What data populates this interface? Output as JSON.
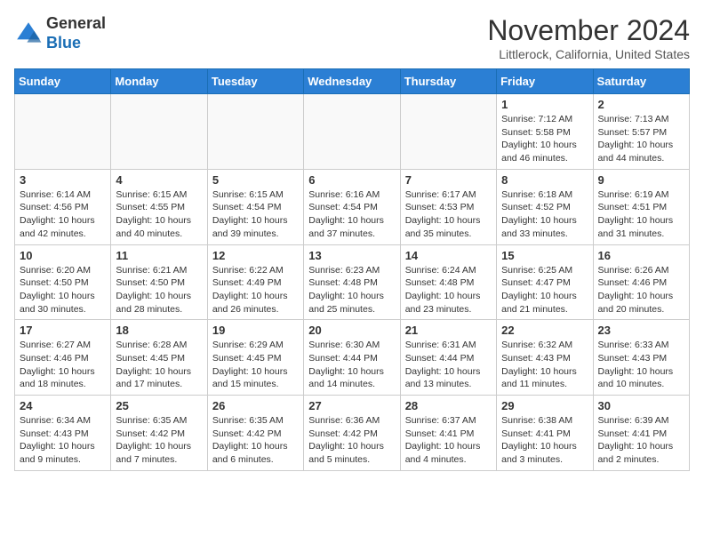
{
  "logo": {
    "general": "General",
    "blue": "Blue"
  },
  "header": {
    "month": "November 2024",
    "location": "Littlerock, California, United States"
  },
  "weekdays": [
    "Sunday",
    "Monday",
    "Tuesday",
    "Wednesday",
    "Thursday",
    "Friday",
    "Saturday"
  ],
  "weeks": [
    [
      {
        "day": "",
        "info": ""
      },
      {
        "day": "",
        "info": ""
      },
      {
        "day": "",
        "info": ""
      },
      {
        "day": "",
        "info": ""
      },
      {
        "day": "",
        "info": ""
      },
      {
        "day": "1",
        "info": "Sunrise: 7:12 AM\nSunset: 5:58 PM\nDaylight: 10 hours\nand 46 minutes."
      },
      {
        "day": "2",
        "info": "Sunrise: 7:13 AM\nSunset: 5:57 PM\nDaylight: 10 hours\nand 44 minutes."
      }
    ],
    [
      {
        "day": "3",
        "info": "Sunrise: 6:14 AM\nSunset: 4:56 PM\nDaylight: 10 hours\nand 42 minutes."
      },
      {
        "day": "4",
        "info": "Sunrise: 6:15 AM\nSunset: 4:55 PM\nDaylight: 10 hours\nand 40 minutes."
      },
      {
        "day": "5",
        "info": "Sunrise: 6:15 AM\nSunset: 4:54 PM\nDaylight: 10 hours\nand 39 minutes."
      },
      {
        "day": "6",
        "info": "Sunrise: 6:16 AM\nSunset: 4:54 PM\nDaylight: 10 hours\nand 37 minutes."
      },
      {
        "day": "7",
        "info": "Sunrise: 6:17 AM\nSunset: 4:53 PM\nDaylight: 10 hours\nand 35 minutes."
      },
      {
        "day": "8",
        "info": "Sunrise: 6:18 AM\nSunset: 4:52 PM\nDaylight: 10 hours\nand 33 minutes."
      },
      {
        "day": "9",
        "info": "Sunrise: 6:19 AM\nSunset: 4:51 PM\nDaylight: 10 hours\nand 31 minutes."
      }
    ],
    [
      {
        "day": "10",
        "info": "Sunrise: 6:20 AM\nSunset: 4:50 PM\nDaylight: 10 hours\nand 30 minutes."
      },
      {
        "day": "11",
        "info": "Sunrise: 6:21 AM\nSunset: 4:50 PM\nDaylight: 10 hours\nand 28 minutes."
      },
      {
        "day": "12",
        "info": "Sunrise: 6:22 AM\nSunset: 4:49 PM\nDaylight: 10 hours\nand 26 minutes."
      },
      {
        "day": "13",
        "info": "Sunrise: 6:23 AM\nSunset: 4:48 PM\nDaylight: 10 hours\nand 25 minutes."
      },
      {
        "day": "14",
        "info": "Sunrise: 6:24 AM\nSunset: 4:48 PM\nDaylight: 10 hours\nand 23 minutes."
      },
      {
        "day": "15",
        "info": "Sunrise: 6:25 AM\nSunset: 4:47 PM\nDaylight: 10 hours\nand 21 minutes."
      },
      {
        "day": "16",
        "info": "Sunrise: 6:26 AM\nSunset: 4:46 PM\nDaylight: 10 hours\nand 20 minutes."
      }
    ],
    [
      {
        "day": "17",
        "info": "Sunrise: 6:27 AM\nSunset: 4:46 PM\nDaylight: 10 hours\nand 18 minutes."
      },
      {
        "day": "18",
        "info": "Sunrise: 6:28 AM\nSunset: 4:45 PM\nDaylight: 10 hours\nand 17 minutes."
      },
      {
        "day": "19",
        "info": "Sunrise: 6:29 AM\nSunset: 4:45 PM\nDaylight: 10 hours\nand 15 minutes."
      },
      {
        "day": "20",
        "info": "Sunrise: 6:30 AM\nSunset: 4:44 PM\nDaylight: 10 hours\nand 14 minutes."
      },
      {
        "day": "21",
        "info": "Sunrise: 6:31 AM\nSunset: 4:44 PM\nDaylight: 10 hours\nand 13 minutes."
      },
      {
        "day": "22",
        "info": "Sunrise: 6:32 AM\nSunset: 4:43 PM\nDaylight: 10 hours\nand 11 minutes."
      },
      {
        "day": "23",
        "info": "Sunrise: 6:33 AM\nSunset: 4:43 PM\nDaylight: 10 hours\nand 10 minutes."
      }
    ],
    [
      {
        "day": "24",
        "info": "Sunrise: 6:34 AM\nSunset: 4:43 PM\nDaylight: 10 hours\nand 9 minutes."
      },
      {
        "day": "25",
        "info": "Sunrise: 6:35 AM\nSunset: 4:42 PM\nDaylight: 10 hours\nand 7 minutes."
      },
      {
        "day": "26",
        "info": "Sunrise: 6:35 AM\nSunset: 4:42 PM\nDaylight: 10 hours\nand 6 minutes."
      },
      {
        "day": "27",
        "info": "Sunrise: 6:36 AM\nSunset: 4:42 PM\nDaylight: 10 hours\nand 5 minutes."
      },
      {
        "day": "28",
        "info": "Sunrise: 6:37 AM\nSunset: 4:41 PM\nDaylight: 10 hours\nand 4 minutes."
      },
      {
        "day": "29",
        "info": "Sunrise: 6:38 AM\nSunset: 4:41 PM\nDaylight: 10 hours\nand 3 minutes."
      },
      {
        "day": "30",
        "info": "Sunrise: 6:39 AM\nSunset: 4:41 PM\nDaylight: 10 hours\nand 2 minutes."
      }
    ]
  ]
}
